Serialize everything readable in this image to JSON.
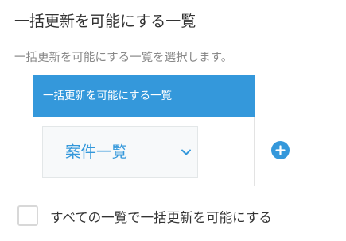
{
  "section": {
    "title": "一括更新を可能にする一覧",
    "description": "一括更新を可能にする一覧を選択します。"
  },
  "list_panel": {
    "header": "一括更新を可能にする一覧",
    "selected_view": "案件一覧",
    "add_icon": "plus-circle-icon",
    "dropdown_icon": "chevron-down-icon"
  },
  "all_views_option": {
    "label": "すべての一覧で一括更新を可能にする",
    "checked": false
  },
  "colors": {
    "accent": "#3498db",
    "header_text": "#ffffff",
    "muted_text": "#888888",
    "select_background": "#f7f9fa"
  }
}
